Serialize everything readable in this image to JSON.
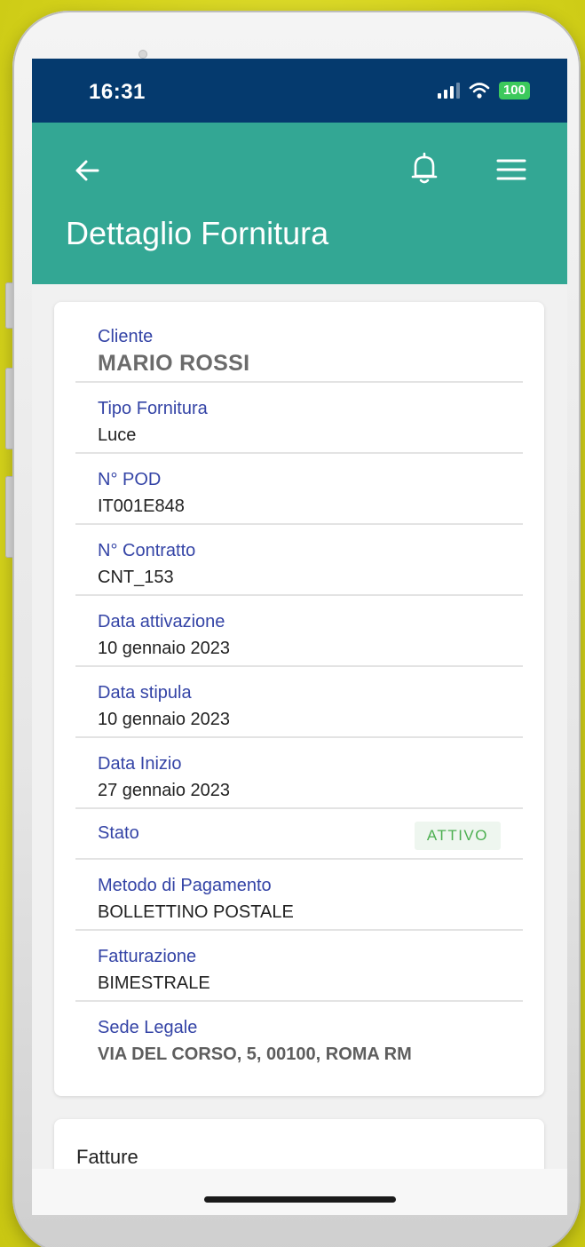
{
  "status_bar": {
    "time": "16:31",
    "battery": "100"
  },
  "header": {
    "title": "Dettaglio Fornitura"
  },
  "details": {
    "client_label": "Cliente",
    "client_value": "MARIO ROSSI",
    "fields": [
      {
        "label": "Tipo Fornitura",
        "value": "Luce"
      },
      {
        "label": "N° POD",
        "value": "IT001E848"
      },
      {
        "label": "N° Contratto",
        "value": "CNT_153"
      },
      {
        "label": "Data attivazione",
        "value": "10 gennaio 2023"
      },
      {
        "label": "Data stipula",
        "value": "10 gennaio 2023"
      },
      {
        "label": "Data Inizio",
        "value": "27 gennaio 2023"
      }
    ],
    "status_label": "Stato",
    "status_value": "ATTIVO",
    "fields2": [
      {
        "label": "Metodo di Pagamento",
        "value": "BOLLETTINO POSTALE"
      },
      {
        "label": "Fatturazione",
        "value": "BIMESTRALE"
      },
      {
        "label": "Sede Legale",
        "value": "VIA DEL CORSO, 5, 00100, ROMA RM"
      }
    ]
  },
  "invoices": {
    "title": "Fatture"
  },
  "colors": {
    "status_bar": "#053a6e",
    "header": "#33a794",
    "label": "#3444a6",
    "status_active": "#4caf50"
  },
  "icons": {
    "back": "arrow-left",
    "bell": "bell",
    "menu": "hamburger"
  }
}
